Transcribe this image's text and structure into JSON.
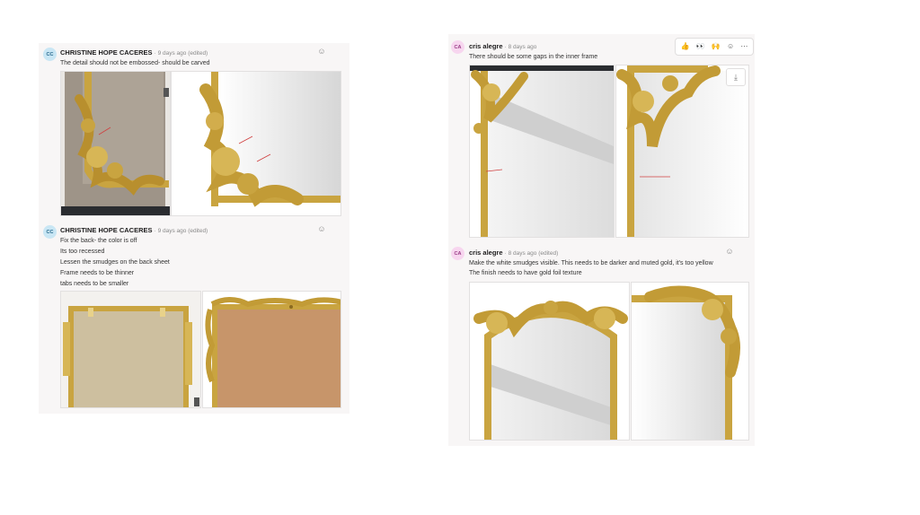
{
  "left_panel": {
    "comments": [
      {
        "avatar": "CC",
        "author": "CHRISTINE HOPE CACERES",
        "time": "· 9 days ago (edited)",
        "lines": [
          "The detail should not be embossed- should be carved"
        ]
      },
      {
        "avatar": "CC",
        "author": "CHRISTINE HOPE CACERES",
        "time": "· 9 days ago (edited)",
        "lines": [
          "Fix the back- the color is off",
          "Its too recessed",
          "Lessen the smudges on the back sheet",
          "Frame needs to be thinner",
          "tabs needs to be smaller"
        ]
      }
    ]
  },
  "right_panel": {
    "toolbar_icons": [
      "thumbs-up-icon",
      "eyes-icon",
      "raised-hands-icon",
      "add-reaction-icon",
      "more-icon"
    ],
    "toolbar_glyphs": [
      "👍",
      "👀",
      "🙌",
      "☺",
      "⋯"
    ],
    "download_glyph": "⤓",
    "react_glyph": "☺",
    "comments": [
      {
        "avatar": "CA",
        "author": "cris alegre",
        "time": "· 8 days ago",
        "lines": [
          "There should be some gaps in the inner frame"
        ]
      },
      {
        "avatar": "CA",
        "author": "cris alegre",
        "time": "· 8 days ago (edited)",
        "lines": [
          "Make the white smudges visible. This needs to be darker and muted gold, it's too yellow",
          "The finish needs to have gold foil texture"
        ]
      }
    ]
  },
  "colors": {
    "gold": "#c9a440",
    "gold_dark": "#9e7a22",
    "gold_light": "#e8d28a",
    "panel_bg": "#f8f6f6",
    "kraft": "#c7956a",
    "linen": "#cdbf9f"
  }
}
